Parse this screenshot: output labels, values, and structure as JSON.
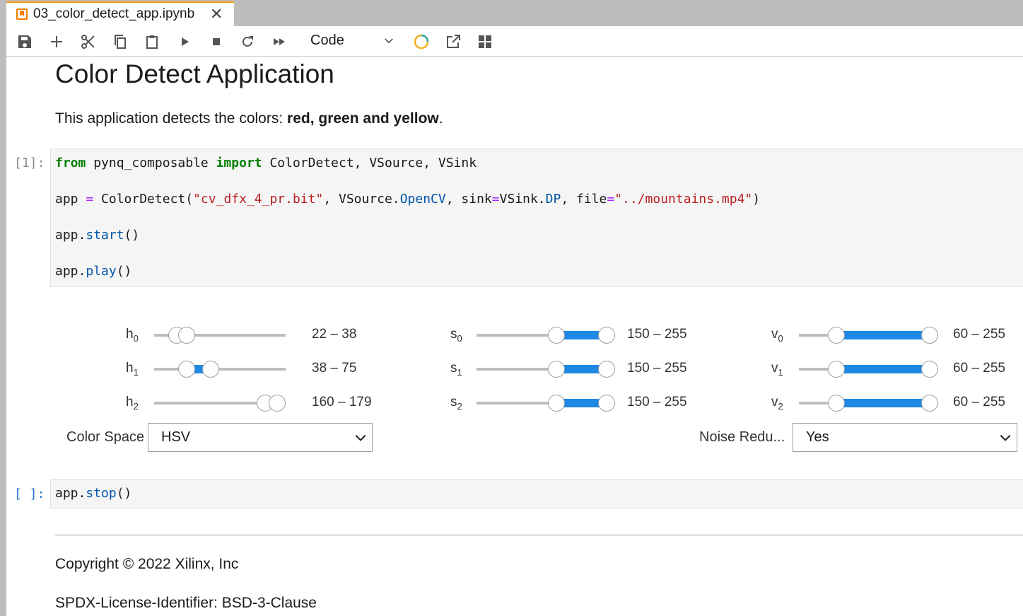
{
  "tab": {
    "title": "03_color_detect_app.ipynb",
    "close": "✕"
  },
  "toolbar": {
    "cell_type": "Code"
  },
  "markdown": {
    "heading": "Color Detect Application",
    "intro_prefix": "This application detects the colors: ",
    "intro_bold": "red, green and yellow",
    "intro_suffix": "."
  },
  "cell1": {
    "prompt": "[1]:",
    "lines": {
      "l1": {
        "a": "from",
        "b": " pynq_composable ",
        "c": "import",
        "d": " ColorDetect, VSource, VSink"
      },
      "l2": {
        "a": "app ",
        "b": "=",
        "c": " ColorDetect(",
        "d": "\"cv_dfx_4_pr.bit\"",
        "e": ", VSource.",
        "f": "OpenCV",
        "g": ", sink",
        "h": "=",
        "i": "VSink.",
        "j": "DP",
        "k": ", file",
        "l": "=",
        "m": "\"../mountains.mp4\"",
        "n": ")"
      },
      "l3": {
        "a": "app.",
        "b": "start",
        "c": "()"
      },
      "l4": {
        "a": "app.",
        "b": "play",
        "c": "()"
      }
    }
  },
  "sliders": {
    "h0": {
      "label": "h",
      "sub": "0",
      "range": "22 – 38",
      "low": 22,
      "high": 38,
      "max": 179
    },
    "h1": {
      "label": "h",
      "sub": "1",
      "range": "38 – 75",
      "low": 38,
      "high": 75,
      "max": 179
    },
    "h2": {
      "label": "h",
      "sub": "2",
      "range": "160 – 179",
      "low": 160,
      "high": 179,
      "max": 179
    },
    "s0": {
      "label": "s",
      "sub": "0",
      "range": "150 – 255",
      "low": 150,
      "high": 255,
      "max": 255
    },
    "s1": {
      "label": "s",
      "sub": "1",
      "range": "150 – 255",
      "low": 150,
      "high": 255,
      "max": 255
    },
    "s2": {
      "label": "s",
      "sub": "2",
      "range": "150 – 255",
      "low": 150,
      "high": 255,
      "max": 255
    },
    "v0": {
      "label": "v",
      "sub": "0",
      "range": "60 – 255",
      "low": 60,
      "high": 255,
      "max": 255
    },
    "v1": {
      "label": "v",
      "sub": "1",
      "range": "60 – 255",
      "low": 60,
      "high": 255,
      "max": 255
    },
    "v2": {
      "label": "v",
      "sub": "2",
      "range": "60 – 255",
      "low": 60,
      "high": 255,
      "max": 255
    }
  },
  "dropdowns": {
    "color_space": {
      "label": "Color Space",
      "value": "HSV"
    },
    "noise": {
      "label": "Noise Redu...",
      "value": "Yes"
    }
  },
  "cell2": {
    "prompt": "[ ]:",
    "a": "app.",
    "b": "stop",
    "c": "()"
  },
  "footer": {
    "copyright": "Copyright © 2022 Xilinx, Inc",
    "license": "SPDX-License-Identifier: BSD-3-Clause"
  },
  "colors": {
    "accent": "#1e88e5",
    "tab_accent": "#f39c12",
    "keyword": "#008000",
    "string": "#ba2121"
  }
}
